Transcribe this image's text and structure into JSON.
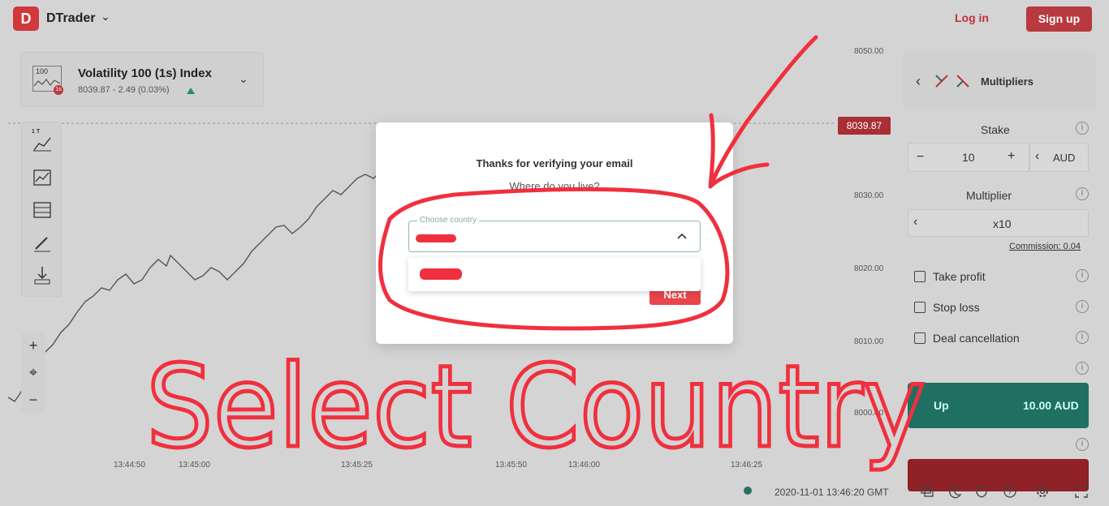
{
  "header": {
    "logo_glyph": "D",
    "brand": "DTrader",
    "brand_chevron": "⌄",
    "login_label": "Log in",
    "signup_label": "Sign up"
  },
  "symbol": {
    "icon_text": "100",
    "badge": "1s",
    "name": "Volatility 100 (1s) Index",
    "price": "8039.87 - 2.49 (0.03%)",
    "trend": "up",
    "chevron": "⌄"
  },
  "chart": {
    "price_axis": [
      "8050.00",
      "8030.00",
      "8020.00",
      "8010.00",
      "8000.00"
    ],
    "current_price": "8039.87",
    "time_axis": [
      "13:44:50",
      "13:45:00",
      "13:45:25",
      "13:45:50",
      "13:46:00",
      "13:46:25"
    ],
    "tools": [
      "chart-type-icon",
      "indicators-icon",
      "templates-icon",
      "drawing-icon",
      "download-icon"
    ],
    "tool_label_1t": "1 T",
    "zoom_in": "+",
    "crosshair": "⌖",
    "zoom_out": "−"
  },
  "panel": {
    "trade_type": "Multipliers",
    "back": "‹",
    "stake_label": "Stake",
    "stake_minus": "−",
    "stake_value": "10",
    "stake_plus": "+",
    "currency_back": "‹",
    "currency": "AUD",
    "multiplier_label": "Multiplier",
    "multiplier_back": "‹",
    "multiplier_value": "x10",
    "commission": "Commission: 0.04",
    "take_profit": "Take profit",
    "stop_loss": "Stop loss",
    "deal_cancellation": "Deal cancellation",
    "info_glyph": "i",
    "up_label": "Up",
    "up_amount": "10.00 AUD"
  },
  "footer": {
    "timestamp": "2020-11-01 13:46:20 GMT",
    "icons": [
      "chat-icon",
      "theme-icon",
      "shield-icon",
      "help-icon",
      "settings-icon",
      "fullscreen-icon"
    ]
  },
  "modal": {
    "title": "Thanks for verifying your email",
    "subtitle": "Where do you live?",
    "country_label": "Choose country",
    "next_label": "Next"
  },
  "annotation": {
    "text": "Select Country",
    "color": "#f0303e"
  },
  "colors": {
    "brand_red": "#d0383c",
    "up_green": "#1f6f63",
    "annotation_red": "#f0303e"
  }
}
